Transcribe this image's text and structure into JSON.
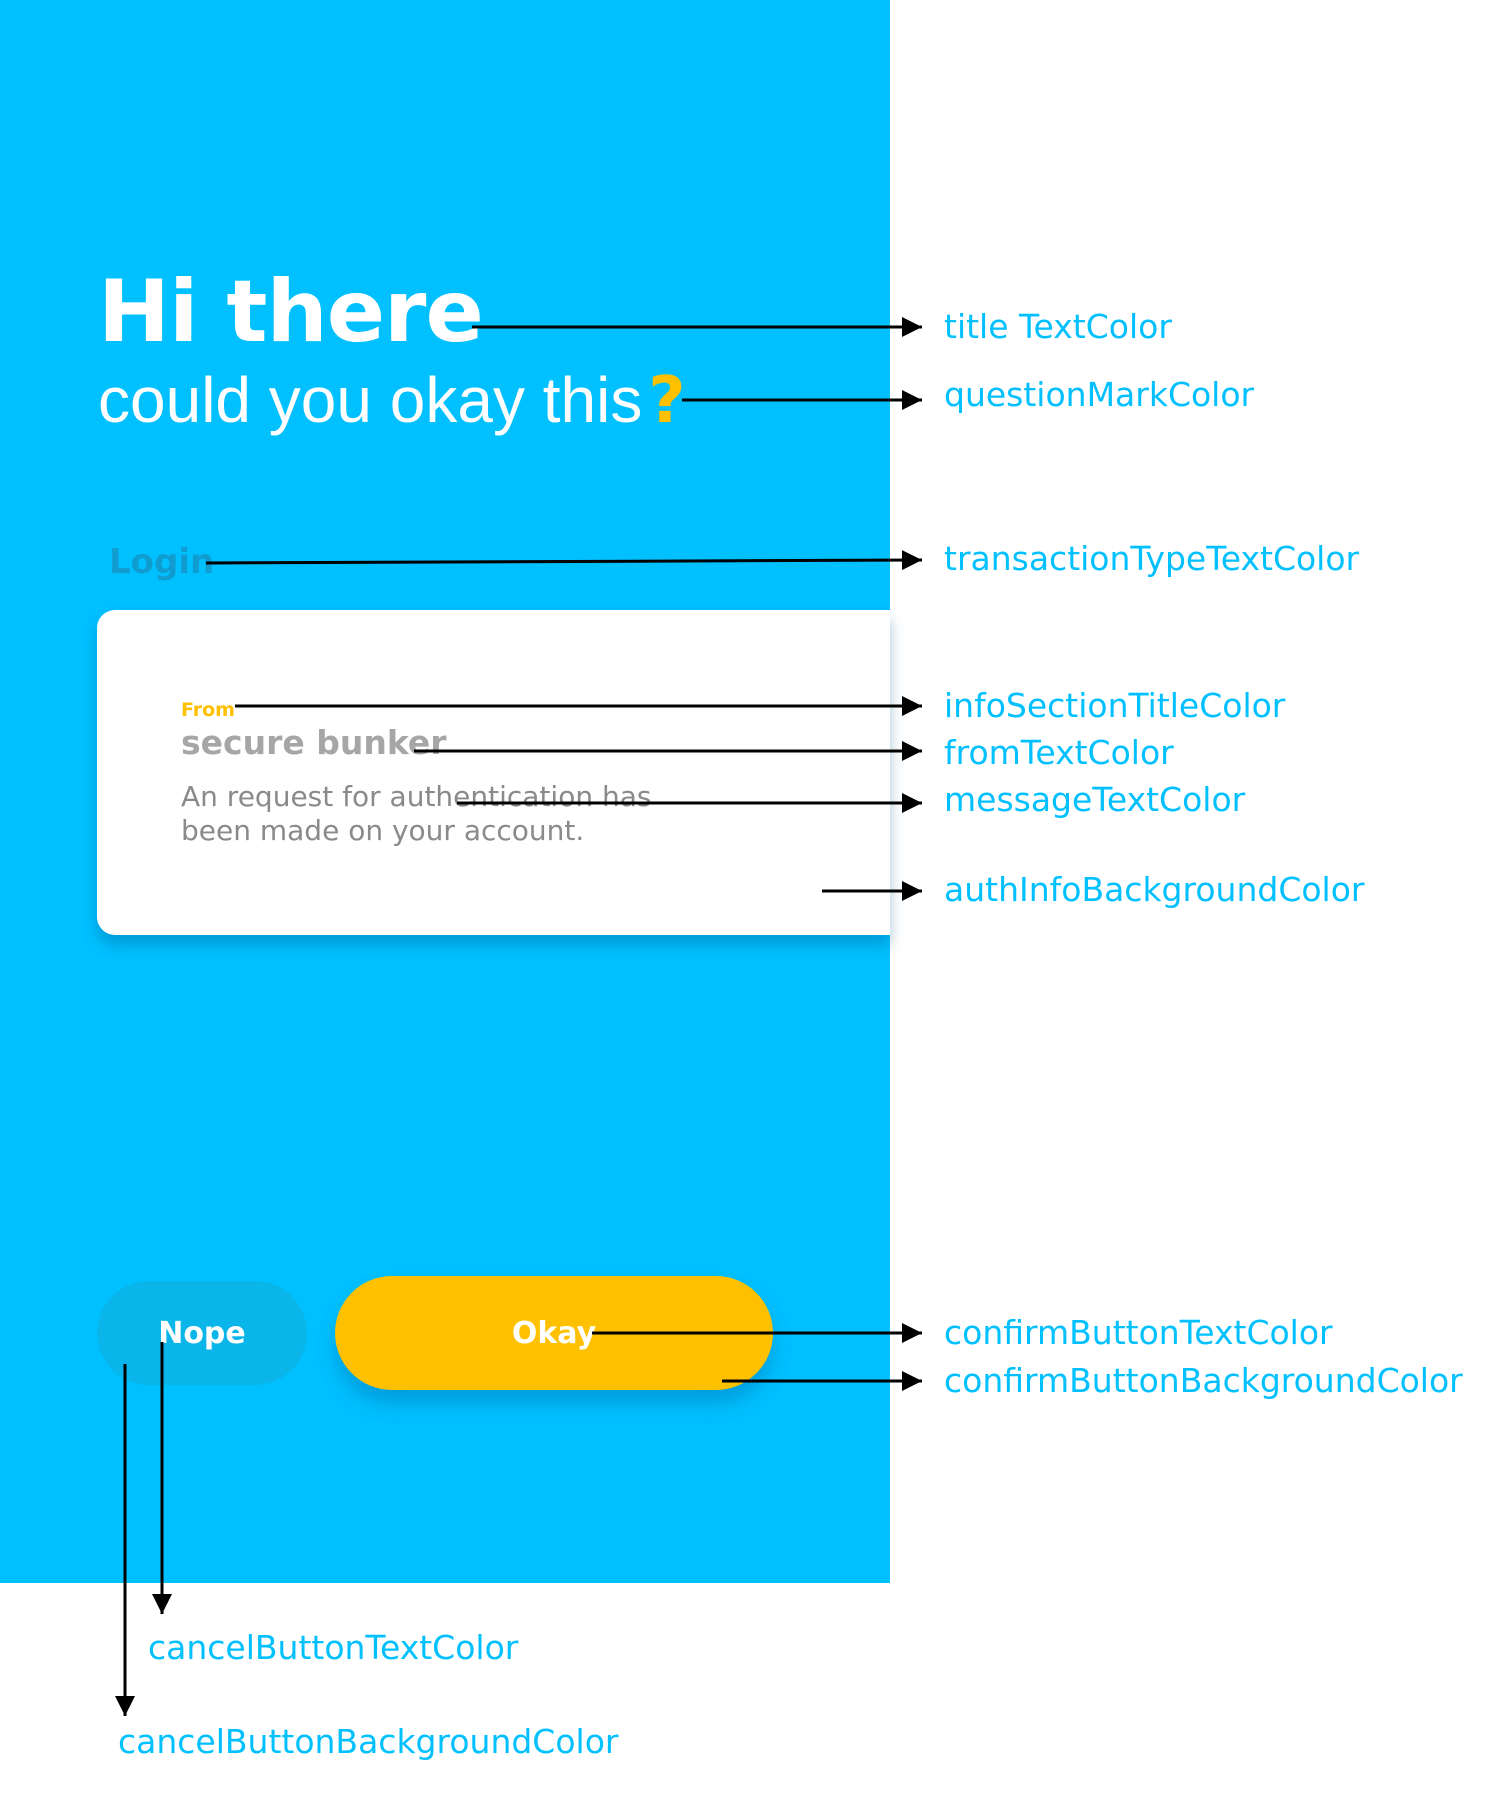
{
  "auth_screen": {
    "title": "Hi there",
    "subtitle": "could you okay this",
    "question_mark": "?",
    "transaction_type": "Login",
    "info_section": {
      "title": "From",
      "from": "secure bunker",
      "message": "An request for authentication has been made on your account."
    },
    "buttons": {
      "cancel_label": "Nope",
      "confirm_label": "Okay"
    }
  },
  "colors": {
    "background": "#00c0ff",
    "title_text": "#ffffff",
    "question_mark": "#ffc000",
    "transaction_type_text": "#119cd0",
    "info_section_title": "#ffc000",
    "from_text": "#a6a6a6",
    "message_text": "#8a8a8a",
    "auth_info_background": "#ffffff",
    "confirm_button_text": "#ffffff",
    "confirm_button_background": "#ffc000",
    "cancel_button_text": "#ffffff",
    "cancel_button_background": "#0ab5ea",
    "annotation_text": "#00c0ff"
  },
  "annotations": {
    "title_text_color": "title TextColor",
    "question_mark_color": "questionMarkColor",
    "transaction_type_text_color": "transactionTypeTextColor",
    "info_section_title_color": "infoSectionTitleColor",
    "from_text_color": "fromTextColor",
    "message_text_color": "messageTextColor",
    "auth_info_background_color": "authInfoBackgroundColor",
    "confirm_button_text_color": "confirmButtonTextColor",
    "confirm_button_background_color": "confirmButtonBackgroundColor",
    "cancel_button_text_color": "cancelButtonTextColor",
    "cancel_button_background_color": "cancelButtonBackgroundColor"
  }
}
